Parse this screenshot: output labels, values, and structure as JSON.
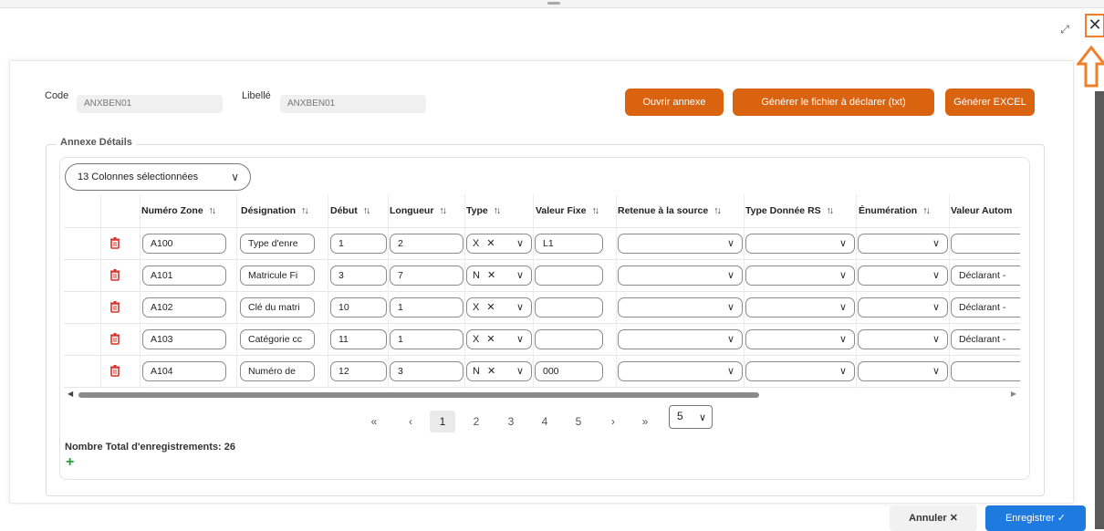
{
  "form": {
    "code_label": "Code",
    "code_value": "ANXBEN01",
    "libelle_label": "Libellé",
    "libelle_value": "ANXBEN01"
  },
  "actions": {
    "open_annex": "Ouvrir annexe",
    "generate_txt": "Générer le fichier à déclarer (txt)",
    "generate_excel": "Générer EXCEL"
  },
  "section": {
    "legend": "Annexe Détails",
    "column_selector": "13 Colonnes sélectionnées"
  },
  "table": {
    "headers": [
      "Numéro Zone",
      "Désignation",
      "Début",
      "Longueur",
      "Type",
      "Valeur Fixe",
      "Retenue à la source",
      "Type Donnée RS",
      "Énumération",
      "Valeur Autom"
    ],
    "sort_glyph": "↑↓",
    "rows": [
      {
        "zone": "A100",
        "designation": "Type d'enre",
        "debut": "1",
        "longueur": "2",
        "type": "X",
        "valeur_fixe": "L1",
        "valeur_auto": ""
      },
      {
        "zone": "A101",
        "designation": "Matricule Fi",
        "debut": "3",
        "longueur": "7",
        "type": "N",
        "valeur_fixe": "",
        "valeur_auto": "Déclarant -"
      },
      {
        "zone": "A102",
        "designation": "Clé du matri",
        "debut": "10",
        "longueur": "1",
        "type": "X",
        "valeur_fixe": "",
        "valeur_auto": "Déclarant -"
      },
      {
        "zone": "A103",
        "designation": "Catégorie cc",
        "debut": "11",
        "longueur": "1",
        "type": "X",
        "valeur_fixe": "",
        "valeur_auto": "Déclarant -"
      },
      {
        "zone": "A104",
        "designation": "Numéro de",
        "debut": "12",
        "longueur": "3",
        "type": "N",
        "valeur_fixe": "000",
        "valeur_auto": ""
      }
    ]
  },
  "pagination": {
    "first": "«",
    "prev": "‹",
    "pages": [
      "1",
      "2",
      "3",
      "4",
      "5"
    ],
    "active_page": "1",
    "next": "›",
    "last": "»",
    "page_size": "5"
  },
  "footer": {
    "total": "Nombre Total d'enregistrements: 26",
    "add": "+"
  },
  "buttons": {
    "cancel": "Annuler ✕",
    "save": "Enregistrer ✓"
  },
  "window": {
    "close": "✕",
    "expand": "⤢"
  },
  "colors": {
    "primary_orange": "#d9630f",
    "save_blue": "#1f7ae0",
    "trash_red": "#d9342b",
    "add_green": "#2e9c3c"
  }
}
